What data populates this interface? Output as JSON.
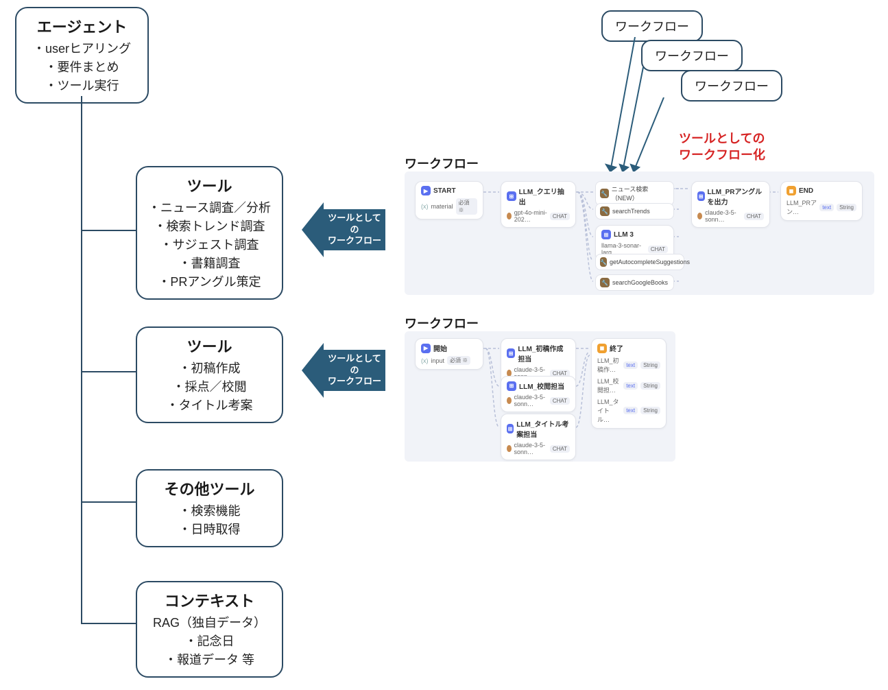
{
  "agent": {
    "title": "エージェント",
    "items": [
      "・userヒアリング",
      "・要件まとめ",
      "・ツール実行"
    ]
  },
  "tool1": {
    "title": "ツール",
    "items": [
      "・ニュース調査／分析",
      "・検索トレンド調査",
      "・サジェスト調査",
      "・書籍調査",
      "・PRアングル策定"
    ]
  },
  "tool2": {
    "title": "ツール",
    "items": [
      "・初稿作成",
      "・採点／校閲",
      "・タイトル考案"
    ]
  },
  "other": {
    "title": "その他ツール",
    "items": [
      "・検索機能",
      "・日時取得"
    ]
  },
  "context": {
    "title": "コンテキスト",
    "items": [
      "RAG（独自データ）",
      "・記念日",
      "・報道データ 等"
    ]
  },
  "arrow_label1a": "ツールとしての",
  "arrow_label1b": "ワークフロー",
  "arrow_label2a": "ツールとしての",
  "arrow_label2b": "ワークフロー",
  "wf_label1": "ワークフロー",
  "wf_label2": "ワークフロー",
  "wf_bubble1": "ワークフロー",
  "wf_bubble2": "ワークフロー",
  "wf_bubble3": "ワークフロー",
  "red_annot_a": "ツールとしての",
  "red_annot_b": "ワークフロー化",
  "wf1": {
    "start": {
      "label": "START",
      "sub": "material",
      "tag": "必須 ※"
    },
    "llm1": {
      "label": "LLM_クエリ抽出",
      "model": "gpt-4o-mini-202…",
      "tag": "CHAT"
    },
    "news": {
      "label": "ニュース検索（NEW）"
    },
    "trends": {
      "label": "searchTrends"
    },
    "llm3": {
      "label": "LLM 3",
      "model": "llama-3-sonar-larg…",
      "tag": "CHAT"
    },
    "autocomplete": {
      "label": "getAutocompleteSuggestions"
    },
    "books": {
      "label": "searchGoogleBooks"
    },
    "out": {
      "label": "LLM_PRアングルを出力",
      "model": "claude-3-5-sonn…",
      "tag": "CHAT"
    },
    "end": {
      "label": "END",
      "sub": "LLM_PRアン…",
      "subtag": "text",
      "type": "String"
    }
  },
  "wf2": {
    "start": {
      "label": "開始",
      "sub": "input",
      "tag": "必須 ※"
    },
    "llm1": {
      "label": "LLM_初稿作成担当",
      "model": "claude-3-5-sonn…",
      "tag": "CHAT"
    },
    "llm2": {
      "label": "LLM_校閲担当",
      "model": "claude-3-5-sonn…",
      "tag": "CHAT"
    },
    "llm3": {
      "label": "LLM_タイトル考案担当",
      "model": "claude-3-5-sonn…",
      "tag": "CHAT"
    },
    "end": {
      "label": "終了",
      "rows": [
        {
          "k": "LLM_初稿作…",
          "t": "text",
          "ty": "String"
        },
        {
          "k": "LLM_校閲担…",
          "t": "text",
          "ty": "String"
        },
        {
          "k": "LLM_タイトル…",
          "t": "text",
          "ty": "String"
        }
      ]
    }
  }
}
